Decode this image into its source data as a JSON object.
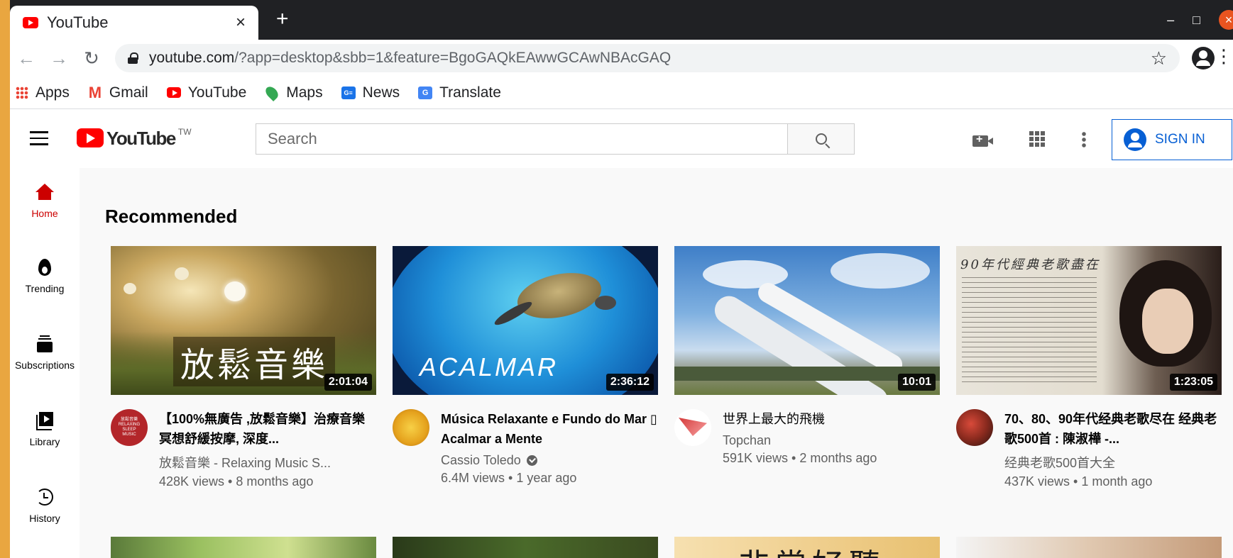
{
  "browser": {
    "tab_title": "YouTube",
    "tab_close": "×",
    "new_tab": "+",
    "url_host": "youtube.com",
    "url_path": "/?app=desktop&sbb=1&feature=BgoGAQkEAwwGCAwNBAcGAQ",
    "bookmarks": [
      {
        "label": "Apps",
        "icon": "apps-icon"
      },
      {
        "label": "Gmail",
        "icon": "gmail-icon"
      },
      {
        "label": "YouTube",
        "icon": "youtube-icon"
      },
      {
        "label": "Maps",
        "icon": "maps-icon"
      },
      {
        "label": "News",
        "icon": "news-icon"
      },
      {
        "label": "Translate",
        "icon": "translate-icon"
      }
    ]
  },
  "youtube": {
    "logo_word": "YouTube",
    "logo_region": "TW",
    "search_placeholder": "Search",
    "sign_in": "SIGN IN",
    "sidebar": [
      {
        "label": "Home",
        "icon": "home-icon",
        "active": true
      },
      {
        "label": "Trending",
        "icon": "trending-icon"
      },
      {
        "label": "Subscriptions",
        "icon": "subscriptions-icon"
      },
      {
        "label": "Library",
        "icon": "library-icon"
      },
      {
        "label": "History",
        "icon": "history-icon"
      }
    ],
    "section_title": "Recommended",
    "videos": [
      {
        "thumb_text": "放鬆音樂",
        "duration": "2:01:04",
        "title": "【100%無廣告 ,放鬆音樂】治療音樂冥想舒緩按摩, 深度...",
        "channel": "放鬆音樂 - Relaxing Music S...",
        "stats": "428K views • 8 months ago",
        "avatar_text": "放鬆音樂 RELAXING SLEEP MUSIC"
      },
      {
        "thumb_text": "ACALMAR",
        "duration": "2:36:12",
        "title": "Música Relaxante e Fundo do Mar ▯ Acalmar a Mente",
        "channel": "Cassio Toledo",
        "stats": "6.4M views • 1 year ago",
        "verified": true
      },
      {
        "duration": "10:01",
        "title": "世界上最大的飛機",
        "channel": "Topchan",
        "stats": "591K views • 2 months ago"
      },
      {
        "thumb_text": "90年代經典老歌盡在",
        "duration": "1:23:05",
        "title": "70、80、90年代经典老歌尽在 经典老歌500首 : 陳淑樺 -...",
        "channel": "经典老歌500首大全",
        "stats": "437K views • 1 month ago"
      }
    ],
    "row2_partial_text": "非常好聽"
  }
}
